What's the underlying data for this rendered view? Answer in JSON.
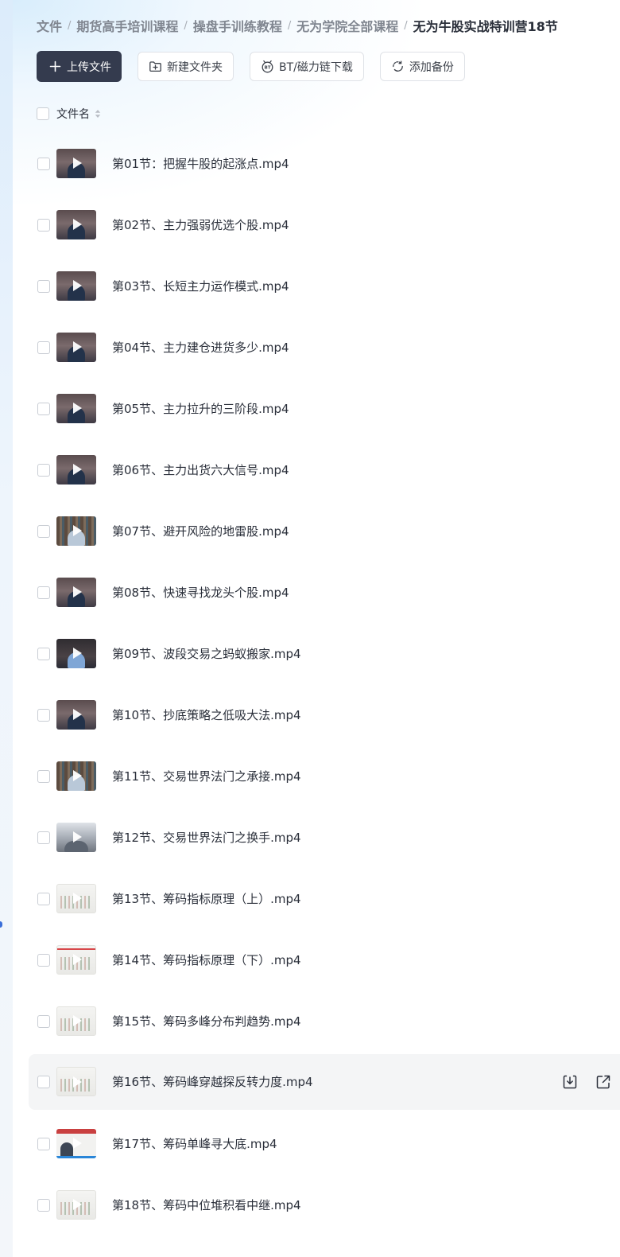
{
  "breadcrumb": {
    "items": [
      {
        "label": "文件"
      },
      {
        "label": "期货高手培训课程"
      },
      {
        "label": "操盘手训练教程"
      },
      {
        "label": "无为学院全部课程"
      },
      {
        "label": "无为牛股实战特训营18节"
      }
    ],
    "separator": "/"
  },
  "toolbar": {
    "upload_label": "上传文件",
    "new_folder_label": "新建文件夹",
    "bt_label": "BT/磁力链下载",
    "backup_label": "添加备份",
    "bt_icon_text": "BT"
  },
  "list_header": {
    "filename_label": "文件名"
  },
  "files": [
    {
      "name": "第01节：把握牛股的起涨点.mp4",
      "thumb": "hall"
    },
    {
      "name": "第02节、主力强弱优选个股.mp4",
      "thumb": "hall"
    },
    {
      "name": "第03节、长短主力运作模式.mp4",
      "thumb": "hall"
    },
    {
      "name": "第04节、主力建仓进货多少.mp4",
      "thumb": "hall"
    },
    {
      "name": "第05节、主力拉升的三阶段.mp4",
      "thumb": "hall"
    },
    {
      "name": "第06节、主力出货六大信号.mp4",
      "thumb": "hall"
    },
    {
      "name": "第07节、避开风险的地雷股.mp4",
      "thumb": "shelf"
    },
    {
      "name": "第08节、快速寻找龙头个股.mp4",
      "thumb": "hall"
    },
    {
      "name": "第09节、波段交易之蚂蚁搬家.mp4",
      "thumb": "dark"
    },
    {
      "name": "第10节、抄底策略之低吸大法.mp4",
      "thumb": "hall"
    },
    {
      "name": "第11节、交易世界法门之承接.mp4",
      "thumb": "shelf"
    },
    {
      "name": "第12节、交易世界法门之换手.mp4",
      "thumb": "city"
    },
    {
      "name": "第13节、筹码指标原理（上）.mp4",
      "thumb": "chart"
    },
    {
      "name": "第14节、筹码指标原理（下）.mp4",
      "thumb": "chart-red"
    },
    {
      "name": "第15节、筹码多峰分布判趋势.mp4",
      "thumb": "chart"
    },
    {
      "name": "第16节、筹码峰穿越探反转力度.mp4",
      "thumb": "chart",
      "hovered": true
    },
    {
      "name": "第17节、筹码单峰寻大底.mp4",
      "thumb": "red"
    },
    {
      "name": "第18节、筹码中位堆积看中继.mp4",
      "thumb": "chart"
    }
  ],
  "colors": {
    "primary_button": "#343b4e",
    "breadcrumb_inactive": "#808690",
    "breadcrumb_active": "#2a2f3a",
    "row_hover": "#f4f5f6"
  },
  "icons": {
    "upload": "plus-icon",
    "new_folder": "folder-plus-icon",
    "bt": "bt-magnet-icon",
    "backup": "sync-icon",
    "sort": "sort-icon",
    "row_download": "download-icon",
    "row_share": "share-icon"
  }
}
